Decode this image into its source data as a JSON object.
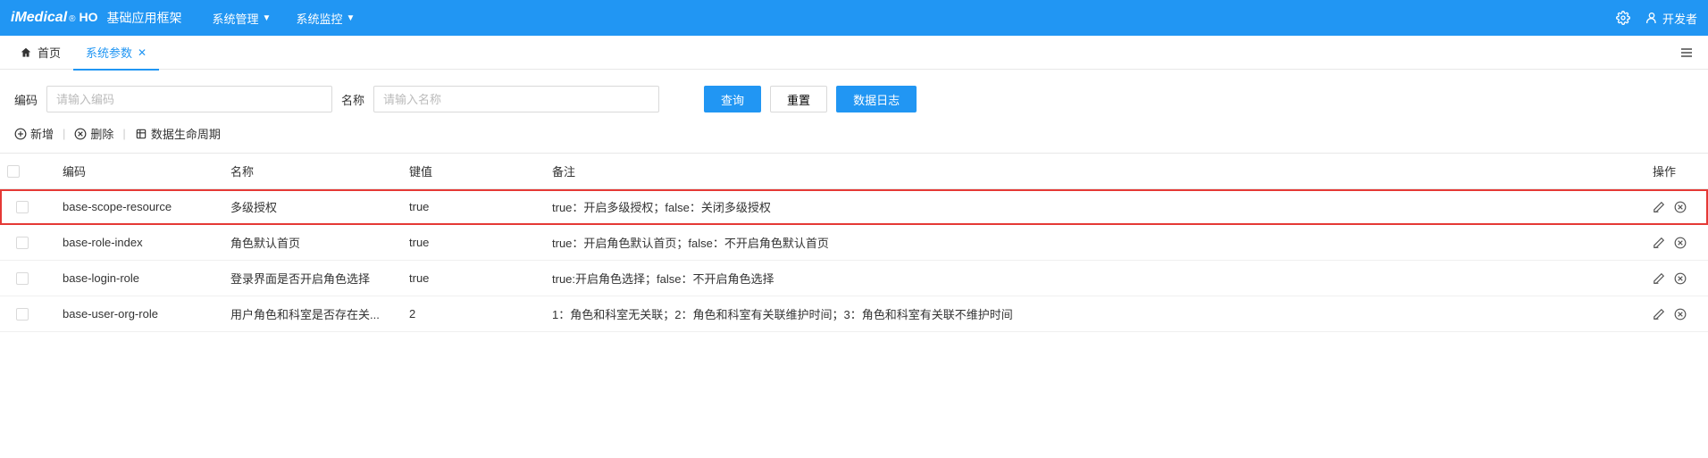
{
  "header": {
    "logo_main": "iMedical",
    "logo_reg": "®",
    "logo_ho": "HO",
    "app_title": "基础应用框架",
    "menus": [
      {
        "label": "系统管理"
      },
      {
        "label": "系统监控"
      }
    ],
    "user_label": "开发者"
  },
  "tabs": {
    "home_label": "首页",
    "items": [
      {
        "label": "系统参数",
        "active": true
      }
    ]
  },
  "filter": {
    "code_label": "编码",
    "code_placeholder": "请输入编码",
    "name_label": "名称",
    "name_placeholder": "请输入名称",
    "btn_query": "查询",
    "btn_reset": "重置",
    "btn_datalog": "数据日志"
  },
  "toolbar": {
    "add_label": "新增",
    "delete_label": "删除",
    "lifecycle_label": "数据生命周期"
  },
  "table": {
    "headers": {
      "code": "编码",
      "name": "名称",
      "value": "键值",
      "remark": "备注",
      "ops": "操作"
    },
    "rows": [
      {
        "code": "base-scope-resource",
        "name": "多级授权",
        "value": "true",
        "remark": "true：开启多级授权；false：关闭多级授权",
        "highlight": true
      },
      {
        "code": "base-role-index",
        "name": "角色默认首页",
        "value": "true",
        "remark": "true：开启角色默认首页；false：不开启角色默认首页",
        "highlight": false
      },
      {
        "code": "base-login-role",
        "name": "登录界面是否开启角色选择",
        "value": "true",
        "remark": "true:开启角色选择；false：不开启角色选择",
        "highlight": false
      },
      {
        "code": "base-user-org-role",
        "name": "用户角色和科室是否存在关...",
        "value": "2",
        "remark": "1：角色和科室无关联；2：角色和科室有关联维护时间；3：角色和科室有关联不维护时间",
        "highlight": false
      }
    ]
  }
}
